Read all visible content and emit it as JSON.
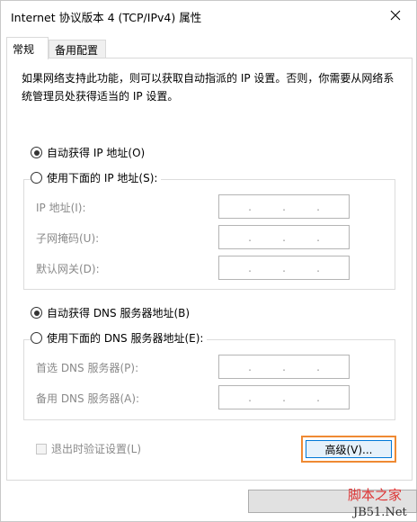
{
  "window": {
    "title": "Internet 协议版本 4 (TCP/IPv4) 属性"
  },
  "tabs": [
    {
      "label": "常规",
      "active": true
    },
    {
      "label": "备用配置",
      "active": false
    }
  ],
  "description": "如果网络支持此功能，则可以获取自动指派的 IP 设置。否则，你需要从网络系统管理员处获得适当的 IP 设置。",
  "ip_section": {
    "auto_label": "自动获得 IP 地址(O)",
    "auto_selected": true,
    "manual_label": "使用下面的 IP 地址(S):",
    "manual_selected": false,
    "fields": [
      {
        "label": "IP 地址(I):",
        "value": ".   .   ."
      },
      {
        "label": "子网掩码(U):",
        "value": ".   .   ."
      },
      {
        "label": "默认网关(D):",
        "value": ".   .   ."
      }
    ]
  },
  "dns_section": {
    "auto_label": "自动获得 DNS 服务器地址(B)",
    "auto_selected": true,
    "manual_label": "使用下面的 DNS 服务器地址(E):",
    "manual_selected": false,
    "fields": [
      {
        "label": "首选 DNS 服务器(P):",
        "value": ".   .   ."
      },
      {
        "label": "备用 DNS 服务器(A):",
        "value": ".   .   ."
      }
    ]
  },
  "validate_checkbox": {
    "label": "退出时验证设置(L)",
    "checked": false,
    "enabled": false
  },
  "advanced_button": {
    "label": "高级(V)..."
  },
  "watermark": {
    "main": "脚本之家",
    "sub": "JB51.Net"
  },
  "colors": {
    "highlight_border": "#ef8a33",
    "focus_border": "#0078d7",
    "disabled_text": "#8a8a8a"
  },
  "icons": {
    "close": "close-icon"
  }
}
